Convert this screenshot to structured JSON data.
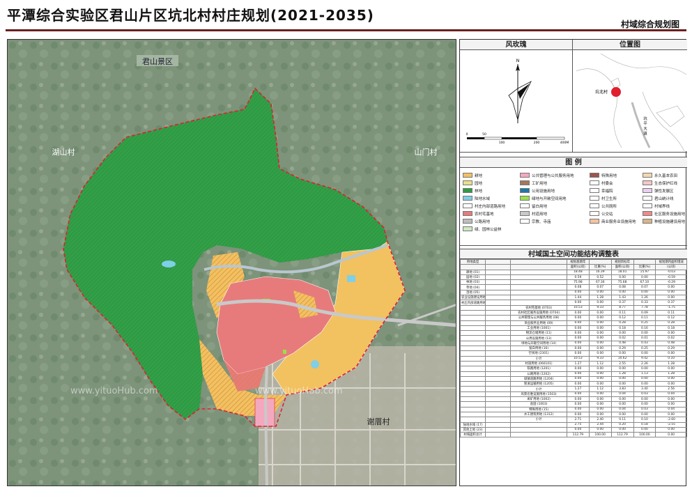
{
  "header": {
    "title": "平潭综合实验区君山片区坑北村村庄规划(2021-2035)",
    "subtitle": "村域综合规划图"
  },
  "map": {
    "place_labels": {
      "junshan": "君山景区",
      "hushan": "湖山村",
      "shanmen": "山门村",
      "xieyao": "谢厝村"
    },
    "watermark": "www.yituoHub.com",
    "colors": {
      "forest": "#2f9a44",
      "farmland": "#f2c160",
      "garden": "#e8e08a",
      "residential": "#e77b7b",
      "boundary": "#e0202e",
      "public": "#f4a8c0",
      "road": "#c9c9c9",
      "water": "#7fcfe6",
      "hatch": "#d0843c"
    }
  },
  "rose": {
    "title": "风玫瑰",
    "north": "N",
    "scale_labels": [
      "0",
      "50",
      "100",
      "200",
      "400M"
    ]
  },
  "location": {
    "title": "位置图",
    "village_label": "坑北村",
    "road_label": "坑 平 大 道"
  },
  "legend": {
    "title": "图 例",
    "items": [
      {
        "label": "耕地",
        "color": "#f2c160"
      },
      {
        "label": "公共管理与公共服务用地",
        "color": "#f4a8c0"
      },
      {
        "label": "特殊用地",
        "color": "#a0524a"
      },
      {
        "label": "永久基本农田",
        "color": "#f3d7b0"
      },
      {
        "label": "园地",
        "color": "#e8e08a"
      },
      {
        "label": "工矿用地",
        "color": "#a3785a"
      },
      {
        "label": "村委会",
        "color": "#ffffff"
      },
      {
        "label": "生态保护红线",
        "color": "#f4c9c9"
      },
      {
        "label": "林地",
        "color": "#2f9a44"
      },
      {
        "label": "公用设施用地",
        "color": "#1f77a6"
      },
      {
        "label": "幸福院",
        "color": "#ffffff"
      },
      {
        "label": "弹性发展区",
        "color": "#e9d0f0"
      },
      {
        "label": "陆地水域",
        "color": "#7fcfe6"
      },
      {
        "label": "绿地与开敞空间用地",
        "color": "#9ae04a"
      },
      {
        "label": "村卫生所",
        "color": "#ffffff"
      },
      {
        "label": "君山统计线",
        "color": "#ffffff"
      },
      {
        "label": "村庄内部道路用地",
        "color": "#ffffff"
      },
      {
        "label": "留白用地",
        "color": "#ffffff"
      },
      {
        "label": "公共厕所",
        "color": "#ffffff"
      },
      {
        "label": "村域界线",
        "color": "#ffffff"
      },
      {
        "label": "农村宅基地",
        "color": "#e77b7b"
      },
      {
        "label": "村道用地",
        "color": "#c9c9c9"
      },
      {
        "label": "公交站",
        "color": "#ffffff"
      },
      {
        "label": "社区服务设施用地",
        "color": "#f08a8a"
      },
      {
        "label": "公路用地",
        "color": "#bdbdbd"
      },
      {
        "label": "宗教、寺庙",
        "color": "#ffffff"
      },
      {
        "label": "商业服务业设施用地",
        "color": "#f7c3a0"
      },
      {
        "label": "种植设施建设用地",
        "color": "#d8b689"
      },
      {
        "label": "绿、园林公益林",
        "color": "#cfe9c3"
      }
    ]
  },
  "table": {
    "title": "村域国土空间功能结构调整表",
    "header_row1": [
      "用地类型",
      "",
      "",
      "规划基期年",
      "",
      "规划目标年",
      "",
      "规划期内面积增减"
    ],
    "header_row2": [
      "",
      "",
      "",
      "面积(公顷)",
      "比重(%)",
      "面积(公顷)",
      "比重(%)",
      "(公顷)"
    ],
    "rows": [
      [
        "耕地 (01)",
        "",
        "",
        "18.48",
        "16.39",
        "18.01",
        "15.97",
        "-0.03"
      ],
      [
        "园地 (02)",
        "",
        "",
        "0.59",
        "0.52",
        "0.00",
        "0.00",
        "-0.59"
      ],
      [
        "林地 (03)",
        "",
        "",
        "75.98",
        "67.36",
        "75.68",
        "67.10",
        "-0.29"
      ],
      [
        "草地 (04)",
        "",
        "",
        "0.08",
        "0.07",
        "0.08",
        "0.07",
        "0.00"
      ],
      [
        "湿地 (05)",
        "",
        "",
        "0.00",
        "0.00",
        "0.00",
        "0.00",
        "0.00"
      ],
      [
        "农业设施建设用地",
        "",
        "",
        "1.44",
        "1.28",
        "1.43",
        "1.26",
        "0.00"
      ],
      [
        "村庄内部道路用地 (060102)",
        "",
        "",
        "0.00",
        "0.00",
        "0.37",
        "0.33",
        "0.37"
      ],
      [
        "",
        "",
        "农村宅基地 (0703)",
        "10.53",
        "9.33",
        "8.77",
        "7.78",
        "-1.75"
      ],
      [
        "",
        "",
        "农村社区服务设施用地 (0704)",
        "0.00",
        "0.00",
        "0.11",
        "0.09",
        "0.11"
      ],
      [
        "",
        "",
        "公共管理与公共服务用地 (08)",
        "0.00",
        "0.00",
        "0.12",
        "0.11",
        "0.12"
      ],
      [
        "",
        "",
        "商业服务业用地 (09)",
        "0.00",
        "0.00",
        "0.28",
        "0.25",
        "0.28"
      ],
      [
        "",
        "",
        "工业用地 (1001)",
        "0.00",
        "0.00",
        "0.18",
        "0.16",
        "0.18"
      ],
      [
        "",
        "",
        "物流仓储用地 (11)",
        "0.00",
        "0.00",
        "0.00",
        "0.00",
        "0.00"
      ],
      [
        "",
        "",
        "公用设施用地 (13)",
        "0.00",
        "0.00",
        "0.02",
        "0.01",
        "0.02"
      ],
      [
        "",
        "",
        "绿地与开敞空间用地 (14)",
        "0.00",
        "0.00",
        "0.48",
        "0.43",
        "0.48"
      ],
      [
        "",
        "",
        "留白用地 (16)",
        "0.00",
        "0.00",
        "0.29",
        "0.25",
        "0.29"
      ],
      [
        "",
        "",
        "空闲地 (2301)",
        "0.00",
        "0.00",
        "0.00",
        "0.00",
        "0.00"
      ],
      [
        "",
        "",
        "小计",
        "10.53",
        "9.33",
        "10.62",
        "9.42",
        "0.10"
      ],
      [
        "",
        "",
        "村道用地 (060101)",
        "1.27",
        "1.12",
        "2.55",
        "2.26",
        "1.28"
      ],
      [
        "",
        "",
        "铁路用地 (1201)",
        "0.00",
        "0.00",
        "0.00",
        "0.00",
        "0.00"
      ],
      [
        "",
        "",
        "公路用地 (1202)",
        "0.00",
        "0.00",
        "1.28",
        "1.13",
        "1.28"
      ],
      [
        "",
        "",
        "城镇道路用地 (1204)",
        "0.00",
        "0.00",
        "0.00",
        "0.00",
        "0.00"
      ],
      [
        "",
        "",
        "管道运输用地 (1205)",
        "0.00",
        "0.00",
        "0.00",
        "0.00",
        "0.00"
      ],
      [
        "",
        "",
        "小计",
        "1.27",
        "1.12",
        "3.83",
        "3.40",
        "2.56"
      ],
      [
        "",
        "",
        "风景名胜设施用地 (1503)",
        "0.00",
        "0.00",
        "0.04",
        "0.03",
        "0.04"
      ],
      [
        "",
        "",
        "采矿用地 (1002)",
        "0.00",
        "0.00",
        "0.00",
        "0.00",
        "0.00"
      ],
      [
        "",
        "",
        "盐田 (1003)",
        "0.00",
        "0.00",
        "0.00",
        "0.00",
        "0.00"
      ],
      [
        "",
        "",
        "特殊用地 (15)",
        "0.00",
        "0.00",
        "0.04",
        "0.03",
        "0.04"
      ],
      [
        "",
        "",
        "水工建筑用地 (1312)",
        "0.00",
        "0.00",
        "0.00",
        "0.00",
        "0.00"
      ],
      [
        "",
        "",
        "小计",
        "2.71",
        "2.40",
        "0.11",
        "0.10",
        "-2.60"
      ],
      [
        "陆地水域 (17)",
        "",
        "",
        "2.75",
        "2.44",
        "0.20",
        "0.18",
        "-2.55"
      ],
      [
        "其他土地 (23)",
        "",
        "",
        "0.00",
        "0.00",
        "0.00",
        "0.00",
        "0.00"
      ],
      [
        "村域面积总计",
        "",
        "",
        "112.79",
        "100.00",
        "112.79",
        "100.00",
        "0.00"
      ]
    ]
  }
}
